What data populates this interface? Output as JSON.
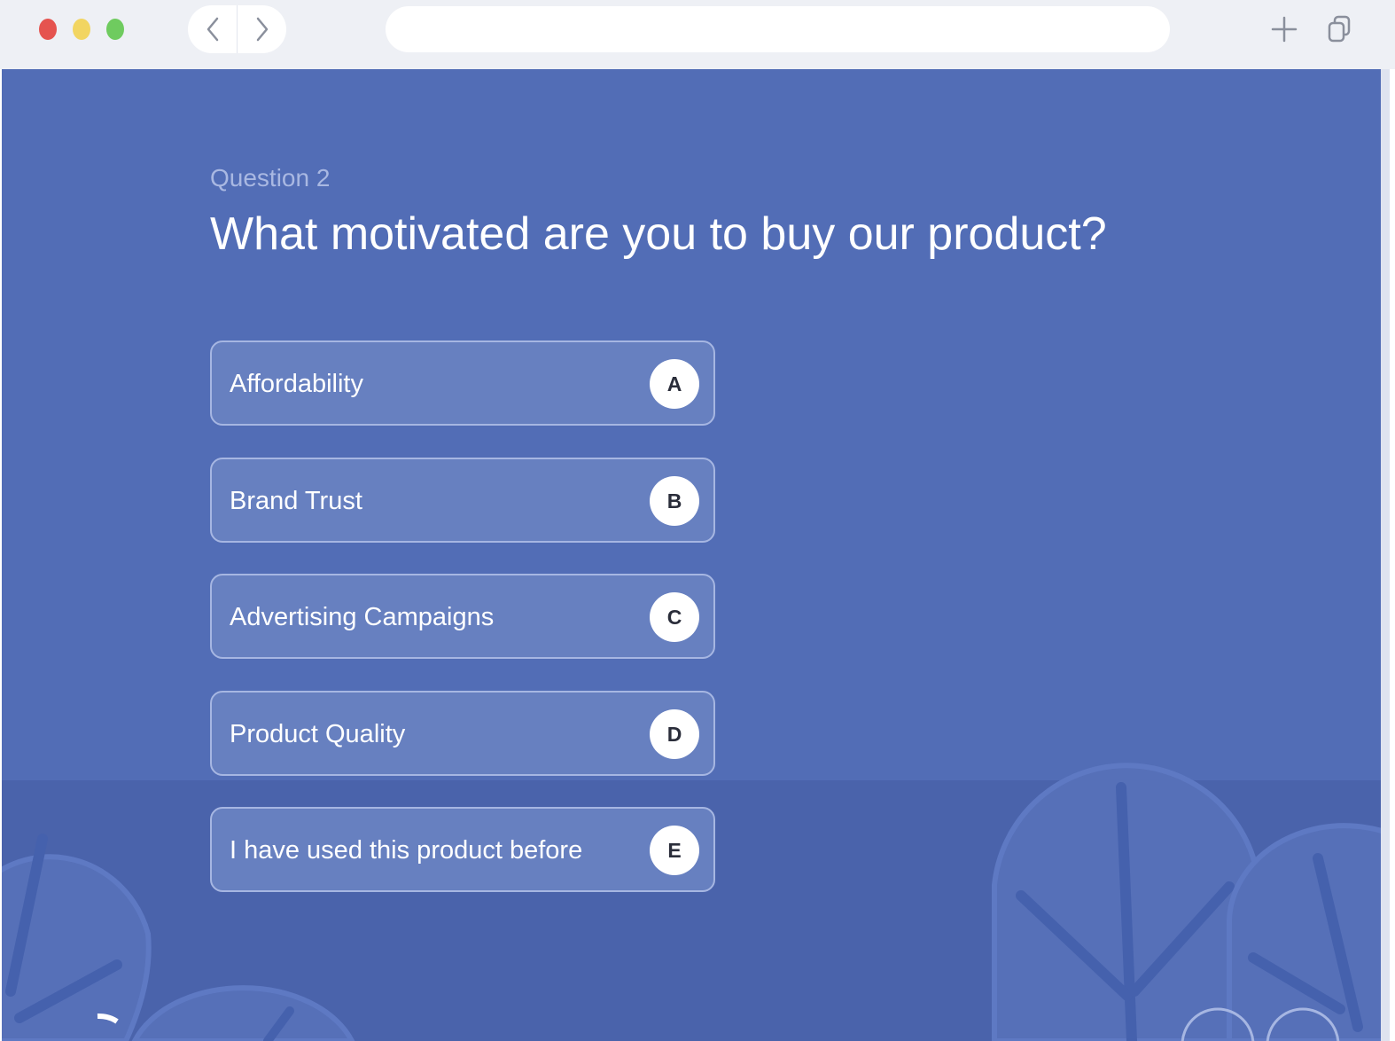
{
  "browser": {
    "back_icon": "chevron-left-icon",
    "forward_icon": "chevron-right-icon",
    "address_value": "",
    "new_tab_icon": "plus-icon",
    "tabs_icon": "copy-icon"
  },
  "survey": {
    "question_number": "Question 2",
    "question_title": "What motivated are you to buy our product?",
    "choices": [
      {
        "label": "Affordability",
        "key": "A"
      },
      {
        "label": "Brand Trust",
        "key": "B"
      },
      {
        "label": "Advertising Campaigns",
        "key": "C"
      },
      {
        "label": "Product Quality",
        "key": "D"
      },
      {
        "label": "I have used this product before",
        "key": "E"
      }
    ]
  },
  "colors": {
    "background": "#526db6",
    "ground": "#4a63ab",
    "choice_fill": "#6780c0",
    "choice_border": "#a6b6e2",
    "question_number": "#a9b8e2"
  }
}
